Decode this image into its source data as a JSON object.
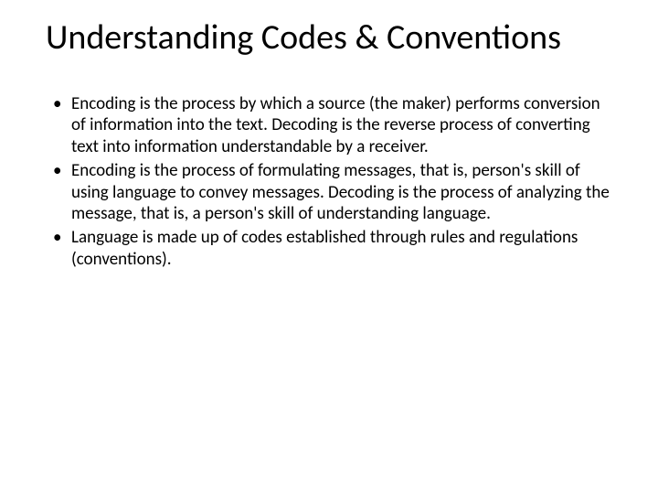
{
  "slide": {
    "title": "Understanding Codes & Conventions",
    "bullets": [
      "Encoding is the process by which a source (the maker) performs conversion of information into the text. Decoding is the reverse process of converting text into information understandable by a receiver.",
      "Encoding is the process of formulating messages, that is, person's skill of using language to convey messages. Decoding is the process of analyzing the message, that is, a person's skill of understanding language.",
      "Language is made up of codes established through rules and regulations (conventions)."
    ]
  }
}
